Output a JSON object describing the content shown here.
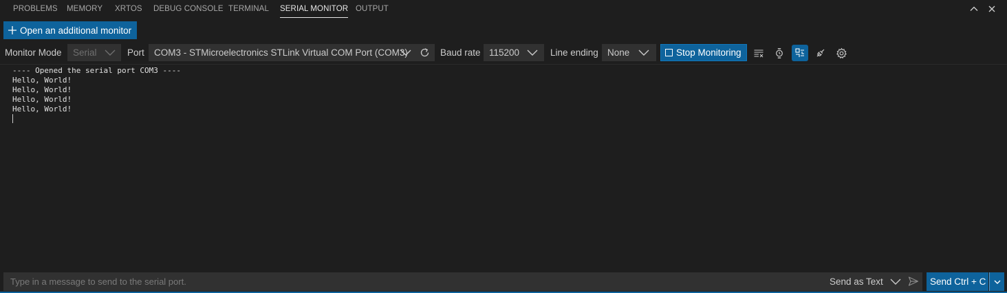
{
  "tabs": [
    {
      "label": "PROBLEMS",
      "active": false
    },
    {
      "label": "MEMORY",
      "active": false
    },
    {
      "label": "XRTOS",
      "active": false
    },
    {
      "label": "DEBUG CONSOLE",
      "active": false
    },
    {
      "label": "TERMINAL",
      "active": false
    },
    {
      "label": "SERIAL MONITOR",
      "active": true
    },
    {
      "label": "OUTPUT",
      "active": false
    }
  ],
  "panel_actions": {
    "maximize_icon": "chevron-up-icon",
    "close_icon": "close-icon"
  },
  "open_monitor": {
    "label": "Open an additional monitor",
    "icon": "plus-icon"
  },
  "toolbar": {
    "monitor_mode_label": "Monitor Mode",
    "monitor_mode_value": "Serial",
    "port_label": "Port",
    "port_value": "COM3 - STMicroelectronics STLink Virtual COM Port (COM3)",
    "baud_label": "Baud rate",
    "baud_value": "115200",
    "line_ending_label": "Line ending",
    "line_ending_value": "None",
    "stop_label": "Stop Monitoring",
    "icons": [
      "refresh-icon",
      "clear-output-icon",
      "timestamp-icon",
      "toggle-terminal-mode-icon",
      "open-in-terminal-icon",
      "settings-icon"
    ]
  },
  "output": {
    "lines": [
      "---- Opened the serial port COM3 ----",
      "Hello, World!",
      "Hello, World!",
      "Hello, World!",
      "Hello, World!"
    ]
  },
  "input": {
    "placeholder": "Type in a message to send to the serial port.",
    "value": "",
    "send_as": "Send as Text",
    "send_button": "Send Ctrl + C"
  },
  "colors": {
    "accent": "#0e639c",
    "background": "#1e1e1e",
    "field": "#313131"
  }
}
